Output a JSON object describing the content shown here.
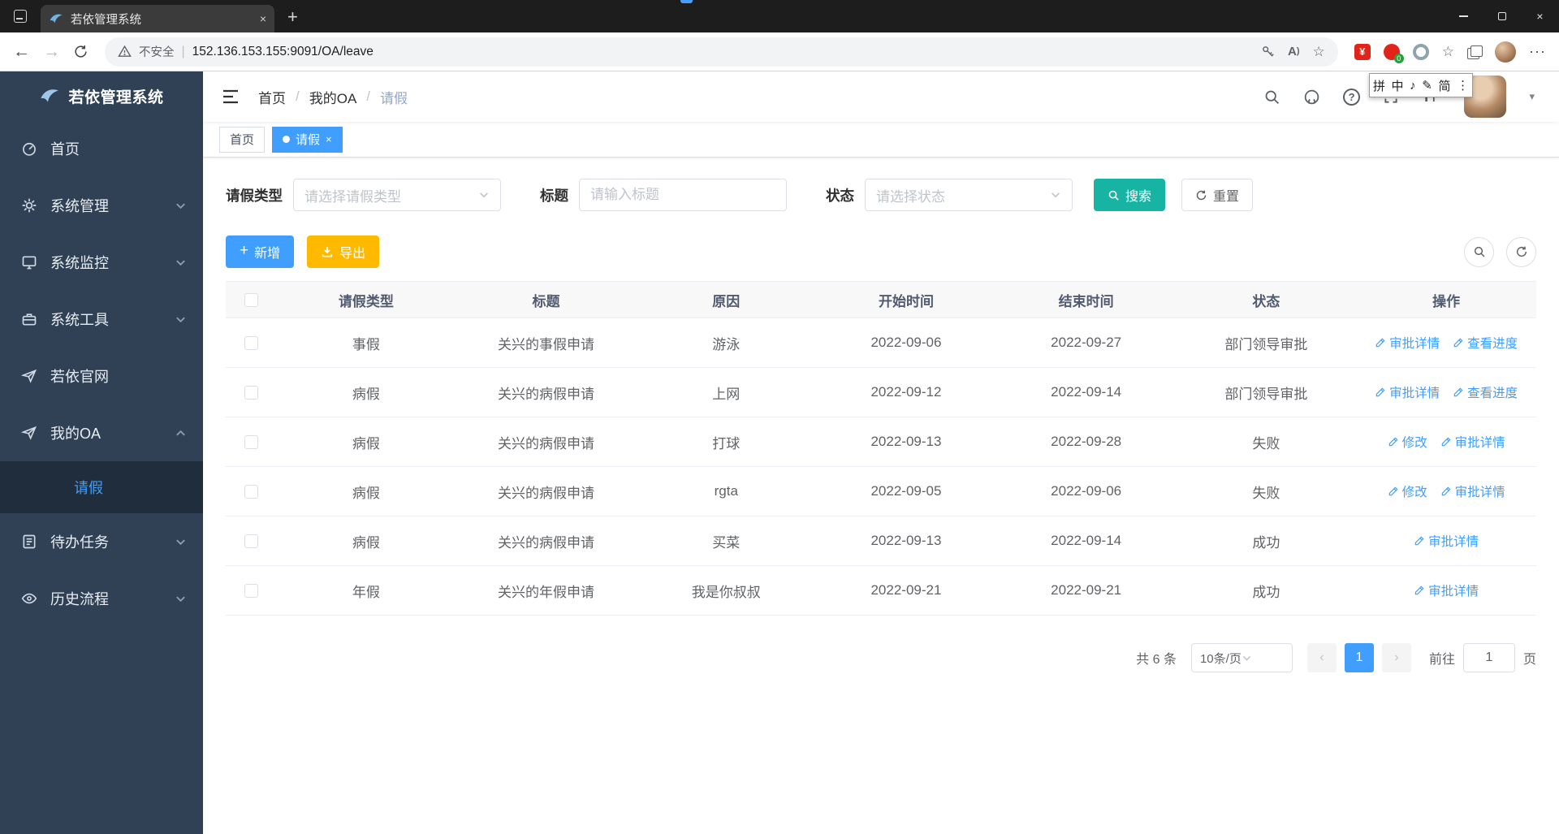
{
  "colors": {
    "primary": "#409eff",
    "search_button": "#17b3a3",
    "export_button": "#ffba00",
    "sidebar_bg": "#304156",
    "sidebar_active_bg": "#1f2d3d",
    "tag_active": "#409eff"
  },
  "browser": {
    "tab_title": "若依管理系统",
    "close_glyph": "×",
    "new_tab_glyph": "+",
    "back_glyph": "←",
    "forward_glyph": "→",
    "security_label": "不安全",
    "url": "152.136.153.155:9091/OA/leave",
    "read_aloud_label": "A",
    "ext_badge": "0",
    "menu_dots": "···",
    "min_label": "",
    "star_glyph": "☆"
  },
  "ime": {
    "glyphs": [
      "拼",
      "中",
      "♪",
      "✎",
      "简",
      "⋮"
    ]
  },
  "sidebar": {
    "logo_text": "若依管理系统",
    "items": [
      {
        "label": "首页"
      },
      {
        "label": "系统管理"
      },
      {
        "label": "系统监控"
      },
      {
        "label": "系统工具"
      },
      {
        "label": "若依官网"
      },
      {
        "label": "我的OA"
      },
      {
        "label": "待办任务"
      },
      {
        "label": "历史流程"
      }
    ],
    "submenu": {
      "leave_label": "请假"
    }
  },
  "navbar": {
    "breadcrumb": [
      "首页",
      "我的OA",
      "请假"
    ],
    "caret": "▾"
  },
  "tags": {
    "home": "首页",
    "active": "请假",
    "close_glyph": "×"
  },
  "filters": {
    "leave_type": {
      "label": "请假类型",
      "placeholder": "请选择请假类型"
    },
    "title": {
      "label": "标题",
      "placeholder": "请输入标题"
    },
    "status": {
      "label": "状态",
      "placeholder": "请选择状态"
    },
    "search_label": "搜索",
    "reset_label": "重置"
  },
  "toolbar": {
    "add_label": "新增",
    "export_label": "导出",
    "plus_glyph": "+"
  },
  "table": {
    "columns": [
      "请假类型",
      "标题",
      "原因",
      "开始时间",
      "结束时间",
      "状态",
      "操作"
    ],
    "rows": [
      {
        "type": "事假",
        "title": "关兴的事假申请",
        "reason": "游泳",
        "start": "2022-09-06",
        "end": "2022-09-27",
        "status": "部门领导审批",
        "actions": [
          "审批详情",
          "查看进度"
        ]
      },
      {
        "type": "病假",
        "title": "关兴的病假申请",
        "reason": "上网",
        "start": "2022-09-12",
        "end": "2022-09-14",
        "status": "部门领导审批",
        "actions": [
          "审批详情",
          "查看进度"
        ]
      },
      {
        "type": "病假",
        "title": "关兴的病假申请",
        "reason": "打球",
        "start": "2022-09-13",
        "end": "2022-09-28",
        "status": "失败",
        "actions": [
          "修改",
          "审批详情"
        ]
      },
      {
        "type": "病假",
        "title": "关兴的病假申请",
        "reason": "rgta",
        "start": "2022-09-05",
        "end": "2022-09-06",
        "status": "失败",
        "actions": [
          "修改",
          "审批详情"
        ]
      },
      {
        "type": "病假",
        "title": "关兴的病假申请",
        "reason": "买菜",
        "start": "2022-09-13",
        "end": "2022-09-14",
        "status": "成功",
        "actions": [
          "审批详情"
        ]
      },
      {
        "type": "年假",
        "title": "关兴的年假申请",
        "reason": "我是你叔叔",
        "start": "2022-09-21",
        "end": "2022-09-21",
        "status": "成功",
        "actions": [
          "审批详情"
        ]
      }
    ]
  },
  "pagination": {
    "total": "共 6 条",
    "page_size": "10条/页",
    "prev": "‹",
    "current": "1",
    "next": "›",
    "goto_label": "前往",
    "goto_value": "1",
    "unit_label": "页"
  }
}
